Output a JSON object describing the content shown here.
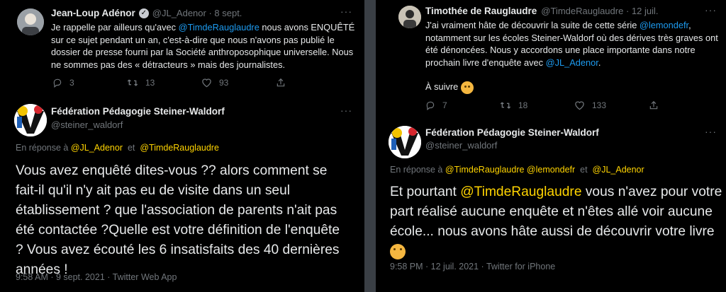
{
  "left": {
    "tweet1": {
      "name": "Jean-Loup Adénor",
      "handle_date": "@JL_Adenor · 8 sept.",
      "lines": [
        [
          "Je rappelle par ailleurs qu'avec ",
          "@TimdeRauglaudre",
          " nous avons ENQUÊTÉ"
        ],
        [
          "sur ce sujet pendant un an, c'est-à-dire que nous n'avons pas publié le"
        ],
        [
          "dossier de presse fourni par la Société anthroposophique universelle. Nous"
        ],
        [
          "ne sommes pas des « détracteurs » mais des journalistes."
        ]
      ],
      "replies": "3",
      "retweets": "13",
      "likes": "93"
    },
    "tweet2": {
      "name": "Fédération Pédagogie Steiner-Waldorf",
      "handle": "@steiner_waldorf",
      "replying_prefix": "En réponse à ",
      "replying_mention1": "@JL_Adenor",
      "replying_and": "  et  ",
      "replying_mention2": "@TimdeRauglaudre",
      "lines": [
        "Vous avez enquêté dites-vous ?? alors comment se",
        "fait-il qu'il n'y ait pas eu de visite dans un seul",
        "établissement ? que l'association de parents n'ait pas",
        "été contactée ?Quelle est votre définition de l'enquête",
        "? Vous avez écouté les 6 insatisfaits des 40 dernières",
        "années !"
      ],
      "meta": "9:58 AM · 9 sept. 2021 · Twitter Web App"
    }
  },
  "right": {
    "tweet1": {
      "name": "Timothée de Rauglaudre",
      "handle_date": "@TimdeRauglaudre · 12 juil.",
      "line1_prefix": "J'ai vraiment hâte de découvrir la suite de cette série ",
      "line1_mention": "@lemondefr",
      "line1_suffix": ",",
      "line2": "notamment sur les écoles Steiner-Waldorf où des dérives très graves ont",
      "line3": "été dénoncées. Nous y accordons une place importante dans notre",
      "line4_prefix": "prochain livre d'enquête avec ",
      "line4_mention": "@JL_Adenor",
      "line4_suffix": ".",
      "line5": "À suivre",
      "replies": "7",
      "retweets": "18",
      "likes": "133"
    },
    "tweet2": {
      "name": "Fédération Pédagogie Steiner-Waldorf",
      "handle": "@steiner_waldorf",
      "replying_prefix": "En réponse à ",
      "replying_mentions": "@TimdeRauglaudre @lemondefr",
      "replying_and": "  et  ",
      "replying_mention_last": "@JL_Adenor",
      "line1_prefix": "Et pourtant ",
      "line1_mention": "@TimdeRauglaudre",
      "line1_suffix": " vous n'avez pour votre",
      "line2": "part réalisé aucune enquête et n'êtes allé voir aucune",
      "line3": "école... nous avons hâte aussi de découvrir votre livre",
      "meta": "9:58 PM · 12 juil. 2021 · Twitter for iPhone"
    }
  },
  "colors": {
    "background": "#000000",
    "mention_blue": "#1d9bf0",
    "mention_yellow": "#ffd400",
    "muted": "#71767b",
    "divider": "#3a3f45"
  }
}
